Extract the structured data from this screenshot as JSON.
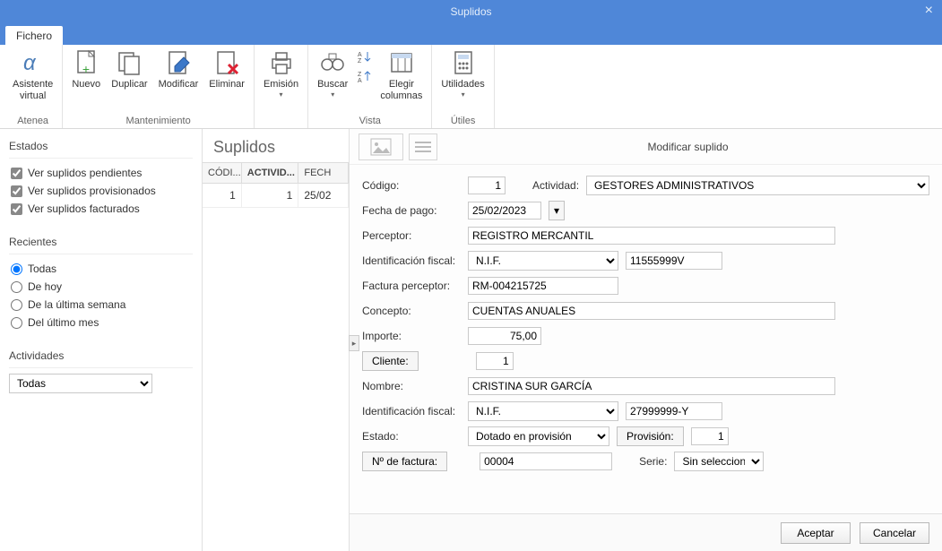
{
  "window": {
    "title": "Suplidos"
  },
  "ribbon": {
    "tab": "Fichero",
    "groups": {
      "atenea": {
        "label": "Atenea",
        "buttons": {
          "asistente": "Asistente\nvirtual"
        }
      },
      "mantenimiento": {
        "label": "Mantenimiento",
        "buttons": {
          "nuevo": "Nuevo",
          "duplicar": "Duplicar",
          "modificar": "Modificar",
          "eliminar": "Eliminar"
        }
      },
      "emision": {
        "buttons": {
          "emision": "Emisión"
        }
      },
      "vista": {
        "label": "Vista",
        "buttons": {
          "buscar": "Buscar",
          "elegir_columnas": "Elegir\ncolumnas"
        }
      },
      "utiles": {
        "label": "Útiles",
        "buttons": {
          "utilidades": "Utilidades"
        }
      }
    }
  },
  "sidebar": {
    "estados": {
      "title": "Estados",
      "items": [
        "Ver suplidos pendientes",
        "Ver suplidos provisionados",
        "Ver suplidos facturados"
      ]
    },
    "recientes": {
      "title": "Recientes",
      "items": [
        "Todas",
        "De hoy",
        "De la última semana",
        "Del último mes"
      ]
    },
    "actividades": {
      "title": "Actividades",
      "selected": "Todas"
    }
  },
  "grid": {
    "title": "Suplidos",
    "columns": [
      "CÓDI...",
      "ACTIVID...",
      "FECH"
    ],
    "rows": [
      {
        "codigo": "1",
        "actividad": "1",
        "fecha": "25/02"
      }
    ]
  },
  "edit": {
    "title": "Modificar suplido",
    "labels": {
      "codigo": "Código:",
      "actividad": "Actividad:",
      "fecha_pago": "Fecha de pago:",
      "perceptor": "Perceptor:",
      "id_fiscal": "Identificación fiscal:",
      "factura_perceptor": "Factura perceptor:",
      "concepto": "Concepto:",
      "importe": "Importe:",
      "cliente": "Cliente:",
      "nombre": "Nombre:",
      "id_fiscal2": "Identificación fiscal:",
      "estado": "Estado:",
      "provision": "Provisión:",
      "n_factura": "Nº de factura:",
      "serie": "Serie:"
    },
    "values": {
      "codigo": "1",
      "actividad": "GESTORES ADMINISTRATIVOS",
      "fecha_pago": "25/02/2023",
      "perceptor": "REGISTRO MERCANTIL",
      "id_fiscal_tipo": "N.I.F.",
      "id_fiscal_num": "11555999V",
      "factura_perceptor": "RM-004215725",
      "concepto": "CUENTAS ANUALES",
      "importe": "75,00",
      "cliente": "1",
      "nombre": "CRISTINA SUR GARCÍA",
      "id_fiscal2_tipo": "N.I.F.",
      "id_fiscal2_num": "27999999-Y",
      "estado": "Dotado en provisión",
      "provision": "1",
      "n_factura": "00004",
      "serie": "Sin seleccionar"
    },
    "buttons": {
      "aceptar": "Aceptar",
      "cancelar": "Cancelar"
    }
  }
}
